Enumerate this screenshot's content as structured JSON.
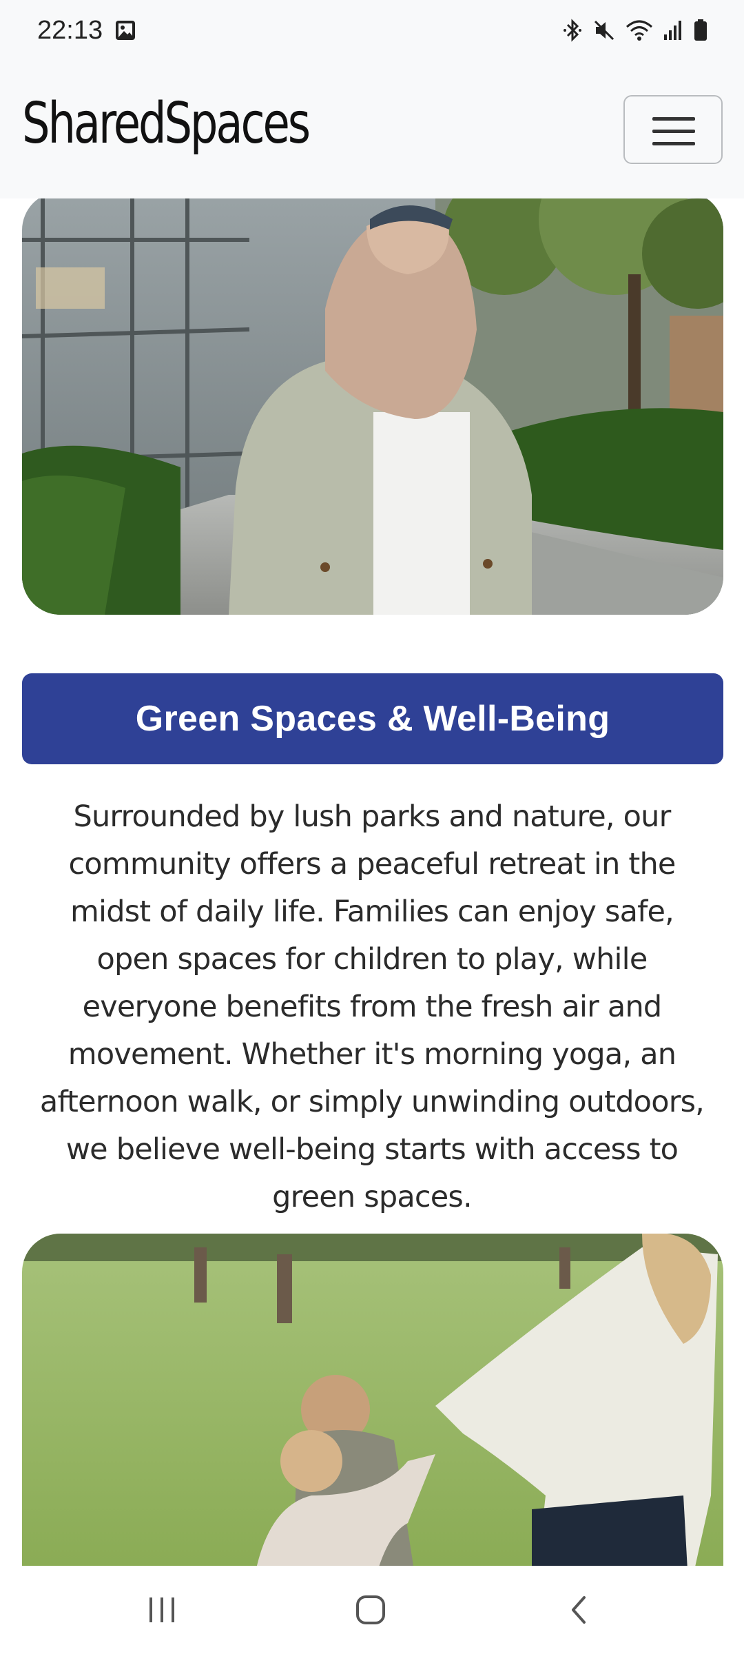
{
  "status_bar": {
    "time": "22:13",
    "icons": [
      "image-icon",
      "bluetooth-icon",
      "mute-icon",
      "wifi-icon",
      "signal-icon",
      "battery-icon"
    ]
  },
  "navbar": {
    "brand": "SharedSpaces",
    "menu_icon": "hamburger-icon"
  },
  "section": {
    "heading": "Green Spaces & Well-Being",
    "body": "Surrounded by lush parks and nature, our community offers a peaceful retreat in the midst of daily life. Families can enjoy safe, open spaces for children to play, while everyone benefits from the fresh air and movement. Whether it's morning yoga, an afternoon walk, or simply unwinding outdoors, we believe well-being starts with access to green spaces."
  },
  "colors": {
    "accent": "#2f4196",
    "navbar_bg": "#f8f9fa"
  },
  "system_nav": {
    "icons": [
      "recent-apps-icon",
      "home-icon",
      "back-icon"
    ]
  }
}
